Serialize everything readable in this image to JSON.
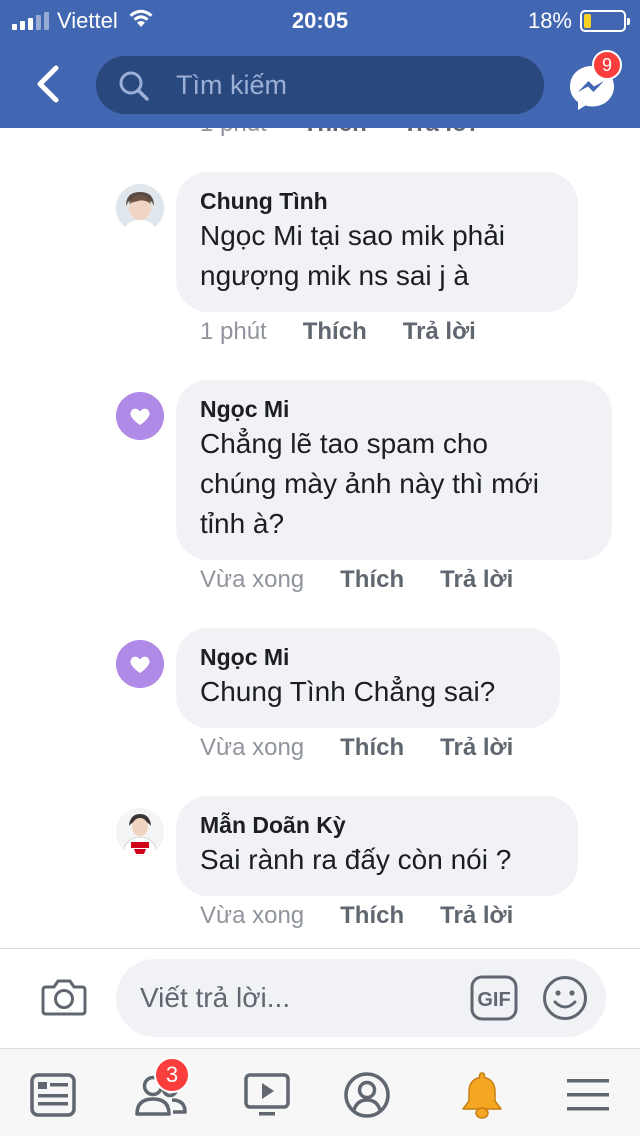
{
  "status_bar": {
    "carrier": "Viettel",
    "time": "20:05",
    "battery_percent": "18%",
    "battery_level": 0.18,
    "battery_color": "#f7d023"
  },
  "header": {
    "background_color": "#4267b2",
    "back_icon": "chevron-left-icon",
    "search": {
      "placeholder": "Tìm kiếm",
      "icon": "search-icon"
    },
    "messenger": {
      "icon": "messenger-icon",
      "badge_count": "9"
    }
  },
  "cut_off_comment": {
    "time": "1 phút",
    "like_label": "Thích",
    "reply_label": "Trả lời"
  },
  "comments": [
    {
      "author": "Chung Tình",
      "avatar": "user-photo",
      "lines": [
        "Ngọc Mi tại sao mik phải",
        "ngượng mik ns sai j à"
      ],
      "time": "1 phút",
      "like_label": "Thích",
      "reply_label": "Trả lời"
    },
    {
      "author": "Ngọc Mi",
      "avatar": "heart-avatar",
      "lines": [
        "Chẳng lẽ tao spam cho",
        "chúng mày ảnh này thì mới",
        "tỉnh à?"
      ],
      "time": "Vừa xong",
      "like_label": "Thích",
      "reply_label": "Trả lời"
    },
    {
      "author": "Ngọc Mi",
      "avatar": "heart-avatar",
      "lines": [
        "Chung Tình Chẳng sai?"
      ],
      "time": "Vừa xong",
      "like_label": "Thích",
      "reply_label": "Trả lời"
    },
    {
      "author": "Mẫn Doãn Kỳ",
      "avatar": "user-photo",
      "lines": [
        "Sai rành ra đấy còn nói ?"
      ],
      "time": "Vừa xong",
      "like_label": "Thích",
      "reply_label": "Trả lời"
    }
  ],
  "composer": {
    "placeholder": "Viết trả lời...",
    "camera_icon": "camera-icon",
    "gif_label": "GIF",
    "emoji_icon": "smiley-icon"
  },
  "tabbar": {
    "items": [
      {
        "name": "news-feed-icon"
      },
      {
        "name": "friends-icon",
        "badge_count": "3"
      },
      {
        "name": "watch-icon"
      },
      {
        "name": "profile-icon"
      },
      {
        "name": "notifications-bell-icon",
        "color": "#f5a623"
      },
      {
        "name": "menu-icon"
      }
    ]
  }
}
